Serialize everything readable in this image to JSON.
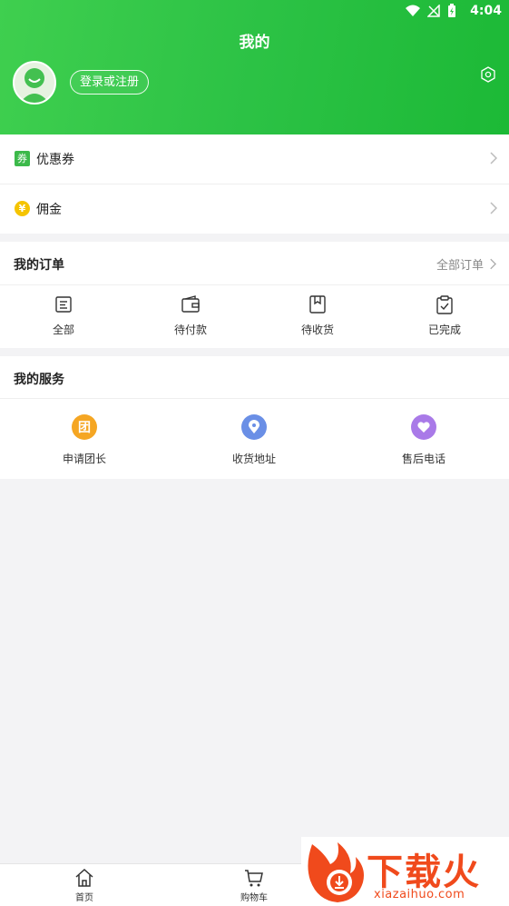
{
  "status": {
    "time": "4:04"
  },
  "header": {
    "title": "我的",
    "login_label": "登录或注册"
  },
  "menu": {
    "coupon": {
      "label": "优惠券",
      "badge": "券"
    },
    "commission": {
      "label": "佣金",
      "badge": "¥"
    }
  },
  "orders": {
    "title": "我的订单",
    "all_label": "全部订单",
    "items": [
      {
        "label": "全部",
        "icon": "list-icon"
      },
      {
        "label": "待付款",
        "icon": "wallet-icon"
      },
      {
        "label": "待收货",
        "icon": "book-icon"
      },
      {
        "label": "已完成",
        "icon": "clipboard-check-icon"
      }
    ]
  },
  "services": {
    "title": "我的服务",
    "items": [
      {
        "label": "申请团长",
        "glyph": "团",
        "color": "#f5a623",
        "icon": "group-icon"
      },
      {
        "label": "收货地址",
        "color": "#6a8fe6",
        "icon": "location-icon"
      },
      {
        "label": "售后电话",
        "color": "#a97ae8",
        "icon": "heart-icon"
      }
    ]
  },
  "tabbar": {
    "items": [
      {
        "label": "首页",
        "icon": "home-icon"
      },
      {
        "label": "购物车",
        "icon": "cart-icon"
      }
    ]
  },
  "watermark": {
    "text": "下载火",
    "sub": "xiazaihuo.com"
  },
  "colors": {
    "brand_green": "#2cc245",
    "accent_yellow": "#f5c400",
    "watermark_red": "#f04a1c"
  }
}
